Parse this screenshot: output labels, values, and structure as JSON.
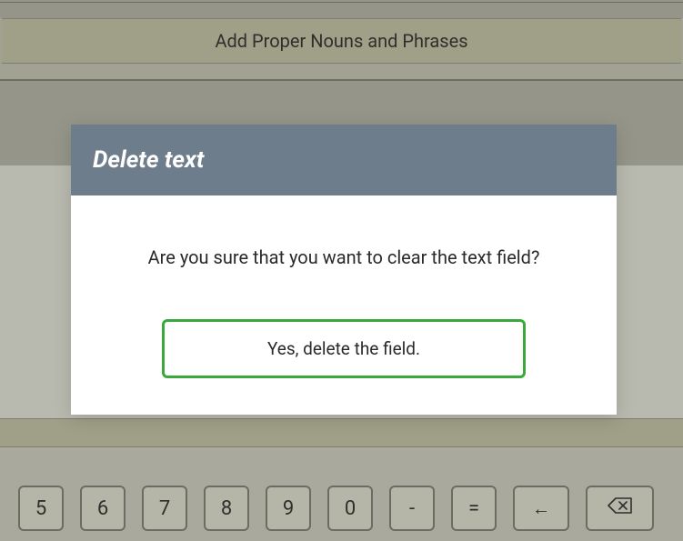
{
  "header": {
    "title": "Add Proper Nouns and Phrases"
  },
  "modal": {
    "title": "Delete text",
    "message": "Are you sure that you want to clear the text field?",
    "confirm_label": "Yes, delete the field."
  },
  "keyboard": {
    "keys": [
      {
        "label": "5",
        "name": "key-5"
      },
      {
        "label": "6",
        "name": "key-6"
      },
      {
        "label": "7",
        "name": "key-7"
      },
      {
        "label": "8",
        "name": "key-8"
      },
      {
        "label": "9",
        "name": "key-9"
      },
      {
        "label": "0",
        "name": "key-0"
      },
      {
        "label": "-",
        "name": "key-minus"
      },
      {
        "label": "=",
        "name": "key-equals"
      },
      {
        "label": "←",
        "name": "key-left-arrow"
      }
    ],
    "backspace_name": "key-backspace"
  }
}
